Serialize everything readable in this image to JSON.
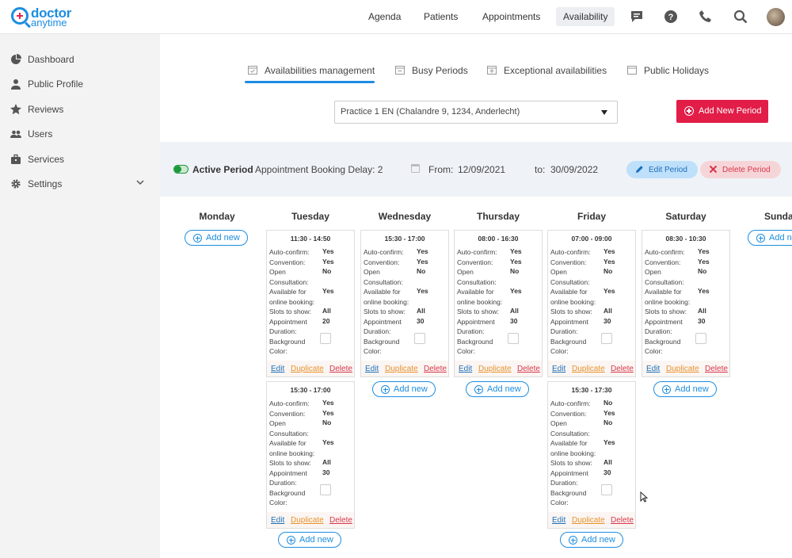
{
  "brand": {
    "line1": "doctor",
    "line2": "anytime",
    "primary": "#1d8de0",
    "accent": "#e0264f"
  },
  "nav": {
    "items": [
      "Agenda",
      "Patients",
      "Appointments",
      "Availability"
    ],
    "active": "Availability"
  },
  "topicons": [
    "chat-icon",
    "help-icon",
    "phone-icon",
    "search-icon",
    "avatar"
  ],
  "sidebar": {
    "items": [
      {
        "label": "Dashboard",
        "icon": "dashboard-icon"
      },
      {
        "label": "Public Profile",
        "icon": "profile-icon"
      },
      {
        "label": "Reviews",
        "icon": "star-icon"
      },
      {
        "label": "Users",
        "icon": "users-icon"
      },
      {
        "label": "Services",
        "icon": "briefcase-icon"
      },
      {
        "label": "Settings",
        "icon": "gear-icon"
      }
    ]
  },
  "subtabs": [
    {
      "label": "Availabilities management"
    },
    {
      "label": "Busy Periods"
    },
    {
      "label": "Exceptional availabilities"
    },
    {
      "label": "Public Holidays"
    }
  ],
  "practice": {
    "selected": "Practice 1 EN (Chalandre 9, 1234, Anderlecht)"
  },
  "add_period_label": "Add New Period",
  "period": {
    "status": "Active Period",
    "booking_delay": "Appointment Booking Delay: 2",
    "from_label": "From:",
    "from": "12/09/2021",
    "to_label": "to:",
    "to": "30/09/2022",
    "edit_label": "Edit Period",
    "delete_label": "Delete Period"
  },
  "labels": {
    "add_new": "Add new",
    "auto_confirm": "Auto-confirm:",
    "convention": "Convention:",
    "open_l1": "Open",
    "open_l2": "Consultation:",
    "online_l1": "Available for",
    "online_l2": "online booking:",
    "slots": "Slots to show:",
    "dur_l1": "Appointment",
    "dur_l2": "Duration:",
    "bg_l1": "Background",
    "bg_l2": "Color:",
    "edit": "Edit",
    "duplicate": "Duplicate",
    "delete": "Delete"
  },
  "days": [
    {
      "name": "Monday",
      "slots": []
    },
    {
      "name": "Tuesday",
      "slots": [
        {
          "time": "11:30 - 14:50",
          "auto_confirm": "Yes",
          "convention": "Yes",
          "open": "No",
          "online": "Yes",
          "slots": "All",
          "duration": "20"
        },
        {
          "time": "15:30 - 17:00",
          "auto_confirm": "Yes",
          "convention": "Yes",
          "open": "No",
          "online": "Yes",
          "slots": "All",
          "duration": "30"
        }
      ]
    },
    {
      "name": "Wednesday",
      "slots": [
        {
          "time": "15:30 - 17:00",
          "auto_confirm": "Yes",
          "convention": "Yes",
          "open": "No",
          "online": "Yes",
          "slots": "All",
          "duration": "30"
        }
      ]
    },
    {
      "name": "Thursday",
      "slots": [
        {
          "time": "08:00 - 16:30",
          "auto_confirm": "Yes",
          "convention": "Yes",
          "open": "No",
          "online": "Yes",
          "slots": "All",
          "duration": "30"
        }
      ]
    },
    {
      "name": "Friday",
      "slots": [
        {
          "time": "07:00 - 09:00",
          "auto_confirm": "Yes",
          "convention": "Yes",
          "open": "No",
          "online": "Yes",
          "slots": "All",
          "duration": "30"
        },
        {
          "time": "15:30 - 17:30",
          "auto_confirm": "No",
          "convention": "Yes",
          "open": "No",
          "online": "Yes",
          "slots": "All",
          "duration": "30"
        }
      ]
    },
    {
      "name": "Saturday",
      "slots": [
        {
          "time": "08:30 - 10:30",
          "auto_confirm": "Yes",
          "convention": "Yes",
          "open": "No",
          "online": "Yes",
          "slots": "All",
          "duration": "30"
        }
      ]
    },
    {
      "name": "Sunday",
      "slots": []
    }
  ]
}
